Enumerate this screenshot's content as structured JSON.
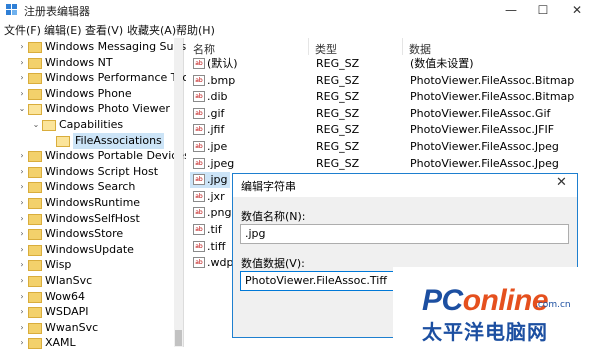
{
  "window": {
    "title": "注册表编辑器",
    "controls": {
      "minimize": "—",
      "maximize": "☐",
      "close": "✕"
    }
  },
  "menu": [
    "文件(F)",
    "编辑(E)",
    "查看(V)",
    "收藏夹(A)",
    "帮助(H)"
  ],
  "tree": [
    {
      "label": "Windows Messaging Subsys",
      "arrow": "›",
      "open": false
    },
    {
      "label": "Windows NT",
      "arrow": "›",
      "open": false
    },
    {
      "label": "Windows Performance Tool",
      "arrow": "›",
      "open": false
    },
    {
      "label": "Windows Phone",
      "arrow": "›",
      "open": false
    },
    {
      "label": "Windows Photo Viewer",
      "arrow": "⌄",
      "open": true
    },
    {
      "label": "Capabilities",
      "arrow": "⌄",
      "open": true
    },
    {
      "label": "FileAssociations",
      "arrow": "",
      "open": false,
      "selected": true
    },
    {
      "label": "Windows Portable Devices",
      "arrow": "›",
      "open": false
    },
    {
      "label": "Windows Script Host",
      "arrow": "›",
      "open": false
    },
    {
      "label": "Windows Search",
      "arrow": "›",
      "open": false
    },
    {
      "label": "WindowsRuntime",
      "arrow": "›",
      "open": false
    },
    {
      "label": "WindowsSelfHost",
      "arrow": "›",
      "open": false
    },
    {
      "label": "WindowsStore",
      "arrow": "›",
      "open": false
    },
    {
      "label": "WindowsUpdate",
      "arrow": "›",
      "open": false
    },
    {
      "label": "Wisp",
      "arrow": "›",
      "open": false
    },
    {
      "label": "WlanSvc",
      "arrow": "›",
      "open": false
    },
    {
      "label": "Wow64",
      "arrow": "›",
      "open": false
    },
    {
      "label": "WSDAPI",
      "arrow": "›",
      "open": false
    },
    {
      "label": "WwanSvc",
      "arrow": "›",
      "open": false
    },
    {
      "label": "XAML",
      "arrow": "›",
      "open": false
    }
  ],
  "list": {
    "headers": {
      "name": "名称",
      "type": "类型",
      "data": "数据"
    },
    "icon_text": "ab",
    "rows": [
      {
        "name": "(默认)",
        "type": "REG_SZ",
        "data": "(数值未设置)"
      },
      {
        "name": ".bmp",
        "type": "REG_SZ",
        "data": "PhotoViewer.FileAssoc.Bitmap"
      },
      {
        "name": ".dib",
        "type": "REG_SZ",
        "data": "PhotoViewer.FileAssoc.Bitmap"
      },
      {
        "name": ".gif",
        "type": "REG_SZ",
        "data": "PhotoViewer.FileAssoc.Gif"
      },
      {
        "name": ".jfif",
        "type": "REG_SZ",
        "data": "PhotoViewer.FileAssoc.JFIF"
      },
      {
        "name": ".jpe",
        "type": "REG_SZ",
        "data": "PhotoViewer.FileAssoc.Jpeg"
      },
      {
        "name": ".jpeg",
        "type": "REG_SZ",
        "data": "PhotoViewer.FileAssoc.Jpeg"
      },
      {
        "name": ".jpg",
        "type": "",
        "data": "",
        "selected": true
      },
      {
        "name": ".jxr",
        "type": "",
        "data": ""
      },
      {
        "name": ".png",
        "type": "",
        "data": ""
      },
      {
        "name": ".tif",
        "type": "",
        "data": ""
      },
      {
        "name": ".tiff",
        "type": "",
        "data": ""
      },
      {
        "name": ".wdp",
        "type": "",
        "data": ""
      }
    ]
  },
  "dialog": {
    "title": "编辑字符串",
    "close": "✕",
    "value_name_label": "数值名称(N):",
    "value_name": ".jpg",
    "value_data_label": "数值数据(V):",
    "value_data": "PhotoViewer.FileAssoc.Tiff"
  },
  "watermark": {
    "logo_a": "PC",
    "logo_b": "online",
    "domain": ".com.cn",
    "cn": "太平洋电脑网"
  }
}
